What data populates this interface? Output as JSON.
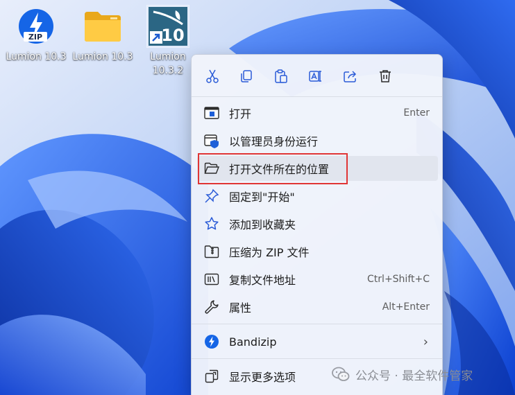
{
  "desktop": {
    "icons": [
      {
        "label": "Lumion 10.3",
        "icon": "bandizip-zip-icon",
        "selected": false
      },
      {
        "label": "Lumion 10.3",
        "icon": "folder-icon",
        "selected": false
      },
      {
        "label": "Lumion 10.3.2",
        "icon": "lumion-shortcut-icon",
        "selected": true
      }
    ]
  },
  "context_menu": {
    "quick_actions": [
      {
        "name": "cut",
        "icon": "scissors-icon"
      },
      {
        "name": "copy",
        "icon": "copy-icon"
      },
      {
        "name": "paste",
        "icon": "paste-icon"
      },
      {
        "name": "rename",
        "icon": "rename-icon"
      },
      {
        "name": "share",
        "icon": "share-icon"
      },
      {
        "name": "delete",
        "icon": "trash-icon"
      }
    ],
    "items": [
      {
        "label": "打开",
        "shortcut": "Enter",
        "icon": "open-app-icon"
      },
      {
        "label": "以管理员身份运行",
        "shortcut": "",
        "icon": "run-as-admin-icon"
      },
      {
        "label": "打开文件所在的位置",
        "shortcut": "",
        "icon": "open-folder-icon",
        "highlighted": true
      },
      {
        "label": "固定到\"开始\"",
        "shortcut": "",
        "icon": "pin-icon"
      },
      {
        "label": "添加到收藏夹",
        "shortcut": "",
        "icon": "star-icon"
      },
      {
        "label": "压缩为 ZIP 文件",
        "shortcut": "",
        "icon": "zip-folder-icon"
      },
      {
        "label": "复制文件地址",
        "shortcut": "Ctrl+Shift+C",
        "icon": "copy-path-icon"
      },
      {
        "label": "属性",
        "shortcut": "Alt+Enter",
        "icon": "wrench-icon"
      }
    ],
    "bandizip": {
      "label": "Bandizip",
      "icon": "bandizip-icon",
      "submenu_indicator": "›"
    },
    "more": {
      "label": "显示更多选项",
      "icon": "more-options-icon"
    }
  },
  "watermark": {
    "text": "公众号 · 最全软件管家"
  },
  "colors": {
    "accent": "#0067c0",
    "highlight_box": "#e03535",
    "wallpaper": "#1f5fe0"
  }
}
